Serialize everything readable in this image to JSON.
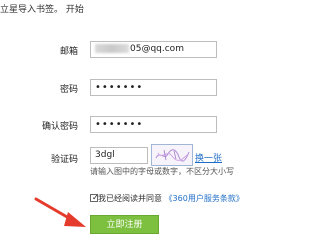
{
  "header": {
    "text": "立星导入书签。 开始"
  },
  "form": {
    "email_label": "邮箱",
    "email_value_visible": "05@qq.com",
    "password_label": "密码",
    "password_value": "•••••••",
    "confirm_label": "确认密码",
    "confirm_value": "•••••••",
    "captcha_label": "验证码",
    "captcha_value": "3dgl",
    "swap_link": "换一张",
    "hint": "请输入图中的字母或数字，不区分大小写",
    "agree_text": "我已经阅读并同意",
    "agree_link": "《360用户服务条款》",
    "submit_label": "立即注册"
  },
  "colors": {
    "accent_link": "#1f6ec7",
    "submit_bg": "#7dbf3e",
    "arrow": "#e53b2c"
  }
}
